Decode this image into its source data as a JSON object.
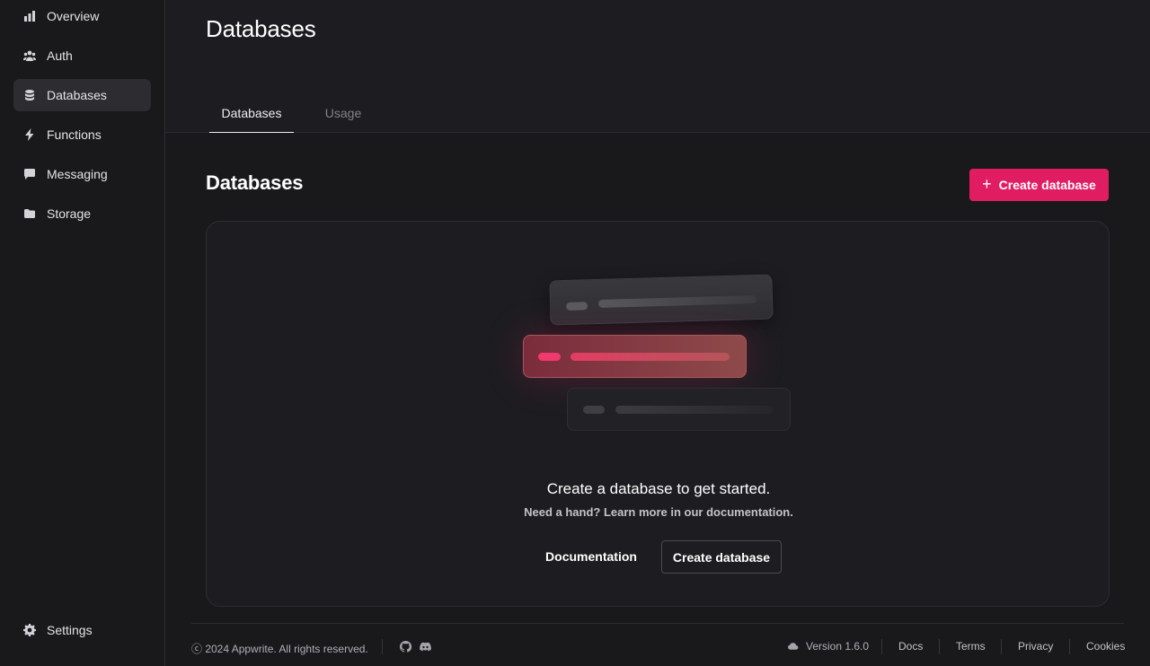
{
  "sidebar": {
    "items": [
      {
        "label": "Overview",
        "icon": "chart-bar-icon"
      },
      {
        "label": "Auth",
        "icon": "users-icon"
      },
      {
        "label": "Databases",
        "icon": "database-icon",
        "active": true
      },
      {
        "label": "Functions",
        "icon": "lightning-icon"
      },
      {
        "label": "Messaging",
        "icon": "chat-icon"
      },
      {
        "label": "Storage",
        "icon": "folder-icon"
      }
    ],
    "settings_label": "Settings"
  },
  "header": {
    "title": "Databases",
    "tabs": [
      {
        "label": "Databases",
        "active": true
      },
      {
        "label": "Usage",
        "active": false
      }
    ]
  },
  "main": {
    "title": "Databases",
    "create_button_label": "Create database",
    "empty_state": {
      "heading": "Create a database to get started.",
      "subtext": "Need a hand? Learn more in our documentation.",
      "documentation_button": "Documentation",
      "create_button": "Create database"
    }
  },
  "footer": {
    "copyright": "ⓒ 2024 Appwrite. All rights reserved.",
    "version": "Version 1.6.0",
    "links": [
      "Docs",
      "Terms",
      "Privacy",
      "Cookies"
    ]
  },
  "colors": {
    "accent": "#e11d62",
    "background": "#19191c"
  }
}
